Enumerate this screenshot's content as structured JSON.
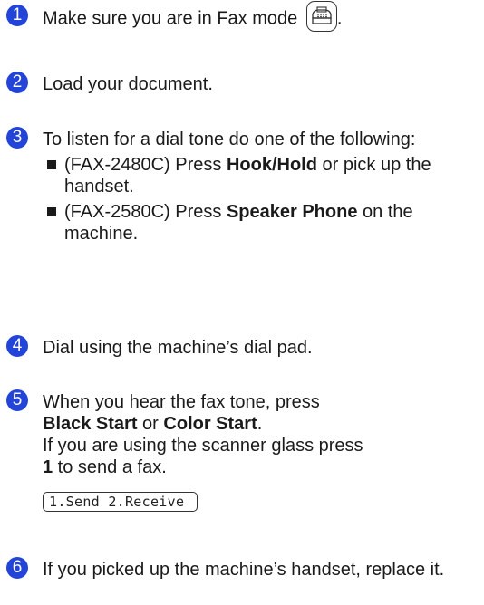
{
  "steps": [
    {
      "num": "1",
      "text": "Make sure you are in Fax mode",
      "suffix": "."
    },
    {
      "num": "2",
      "text": "Load your document."
    },
    {
      "num": "3",
      "text": "To listen for a dial tone do one of the following:",
      "bullets": [
        {
          "prefix": "(FAX-2480C) Press ",
          "bold": "Hook/Hold",
          "suffix": " or pick up the handset."
        },
        {
          "prefix": "(FAX-2580C) Press ",
          "bold": "Speaker Phone",
          "suffix": " on the machine."
        }
      ]
    },
    {
      "num": "4",
      "text": "Dial using the machine’s dial pad."
    },
    {
      "num": "5",
      "line1": "When you hear the fax tone, press",
      "bold1": "Black Start",
      "mid": " or ",
      "bold2": "Color Start",
      "end": ".",
      "line3": "If you are using the scanner glass press",
      "bold3": "1",
      "line4": " to send a fax.",
      "lcd": "1.Send 2.Receive"
    },
    {
      "num": "6",
      "text": "If you picked up the machine’s handset, replace it."
    }
  ],
  "icons": {
    "fax_mode": "fax-mode-icon"
  },
  "colors": {
    "badge": "#2244d8"
  }
}
